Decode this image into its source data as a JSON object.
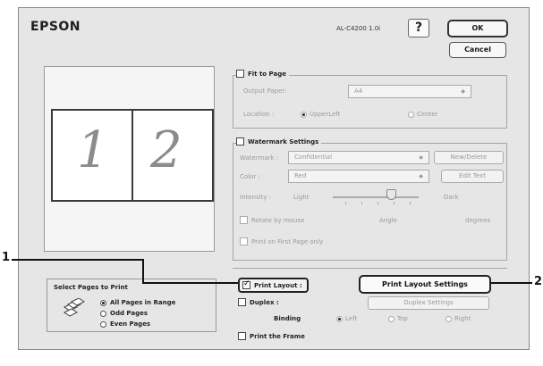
{
  "header": {
    "brand": "EPSON",
    "model": "AL-C4200 1.0i",
    "help_label": "?",
    "ok_label": "OK",
    "cancel_label": "Cancel"
  },
  "preview": {
    "pages": [
      "1",
      "2"
    ]
  },
  "fit_to_page": {
    "checkbox_label": "Fit to Page",
    "output_paper_label": "Output Paper:",
    "output_paper_value": "A4",
    "location_label": "Location :",
    "location_options": [
      "UpperLeft",
      "Center"
    ],
    "location_selected": "UpperLeft"
  },
  "watermark": {
    "checkbox_label": "Watermark Settings",
    "watermark_label": "Watermark :",
    "watermark_value": "Confidential",
    "new_delete_label": "New/Delete",
    "color_label": "Color :",
    "color_value": "Red",
    "edit_text_label": "Edit Text",
    "intensity_label": "Intensity :",
    "intensity_light": "Light",
    "intensity_dark": "Dark",
    "intensity_level": 0.7,
    "rotate_label": "Rotate by mouse",
    "angle_label": "Angle",
    "degrees_label": "degrees",
    "first_page_label": "Print on First Page only"
  },
  "layout": {
    "print_layout_label": "Print Layout :",
    "print_layout_checked": true,
    "print_layout_settings_label": "Print Layout Settings",
    "duplex_label": "Duplex :",
    "duplex_settings_label": "Duplex Settings",
    "binding_label": "Binding",
    "binding_options": [
      "Left",
      "Top",
      "Right"
    ],
    "binding_selected": "Left",
    "print_frame_label": "Print the Frame"
  },
  "select_pages": {
    "title": "Select Pages to Print",
    "options": [
      "All Pages in Range",
      "Odd Pages",
      "Even Pages"
    ],
    "selected": "All Pages in Range"
  },
  "callouts": [
    "1",
    "2"
  ]
}
